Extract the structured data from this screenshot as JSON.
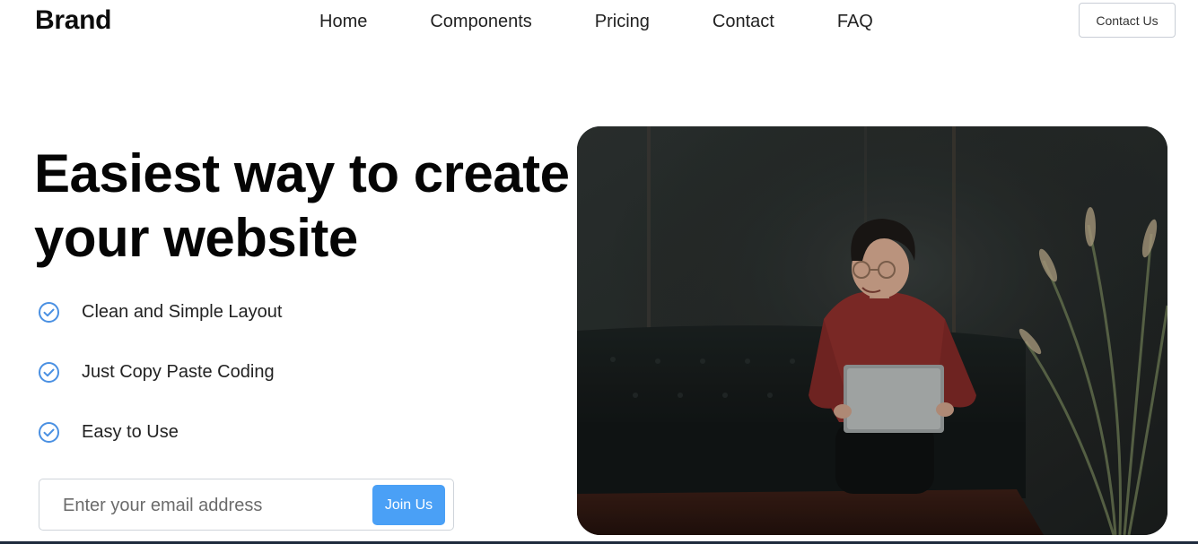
{
  "header": {
    "brand": "Brand",
    "nav": [
      "Home",
      "Components",
      "Pricing",
      "Contact",
      "FAQ"
    ],
    "contact_button": "Contact Us"
  },
  "hero": {
    "title": "Easiest way to create your website",
    "features": [
      "Clean and Simple Layout",
      "Just Copy Paste Coding",
      "Easy to Use"
    ],
    "email_placeholder": "Enter your email address",
    "join_button": "Join Us",
    "image_icon": "photo-person-laptop-icon"
  },
  "colors": {
    "accent": "#4aa0f6",
    "check": "#4a90e2",
    "bottom_bar": "#1f2b3d"
  }
}
